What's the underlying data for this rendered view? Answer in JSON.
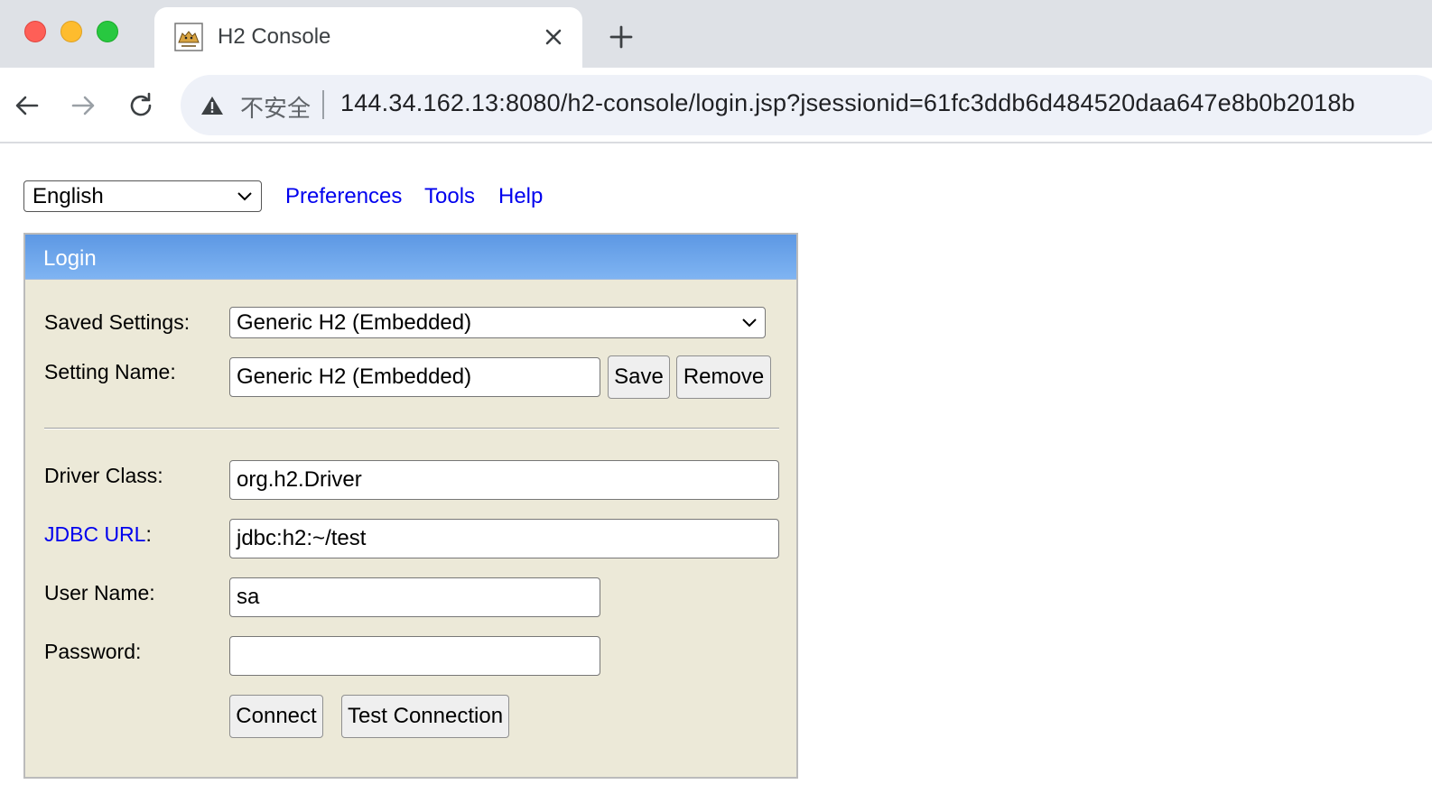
{
  "browser": {
    "tab_title": "H2 Console",
    "insecure_label": "不安全",
    "url_host": "144.34.162.13",
    "url_rest": ":8080/h2-console/login.jsp?jsessionid=61fc3ddb6d484520daa647e8b0b2018b"
  },
  "topbar": {
    "language": "English",
    "links": [
      "Preferences",
      "Tools",
      "Help"
    ]
  },
  "login": {
    "title": "Login",
    "saved_settings_label": "Saved Settings:",
    "saved_settings_value": "Generic H2 (Embedded)",
    "setting_name_label": "Setting Name:",
    "setting_name_value": "Generic H2 (Embedded)",
    "save_label": "Save",
    "remove_label": "Remove",
    "driver_class_label": "Driver Class:",
    "driver_class_value": "org.h2.Driver",
    "jdbc_url_link": "JDBC URL",
    "jdbc_url_colon": ":",
    "jdbc_url_value": "jdbc:h2:~/test",
    "user_name_label": "User Name:",
    "user_name_value": "sa",
    "password_label": "Password:",
    "password_value": "",
    "connect_label": "Connect",
    "test_connection_label": "Test Connection"
  },
  "colors": {
    "link": "#0000ee",
    "panel_bg": "#ece9d8",
    "header_gradient_top": "#5d98e4",
    "header_gradient_bottom": "#7fb4f2"
  }
}
